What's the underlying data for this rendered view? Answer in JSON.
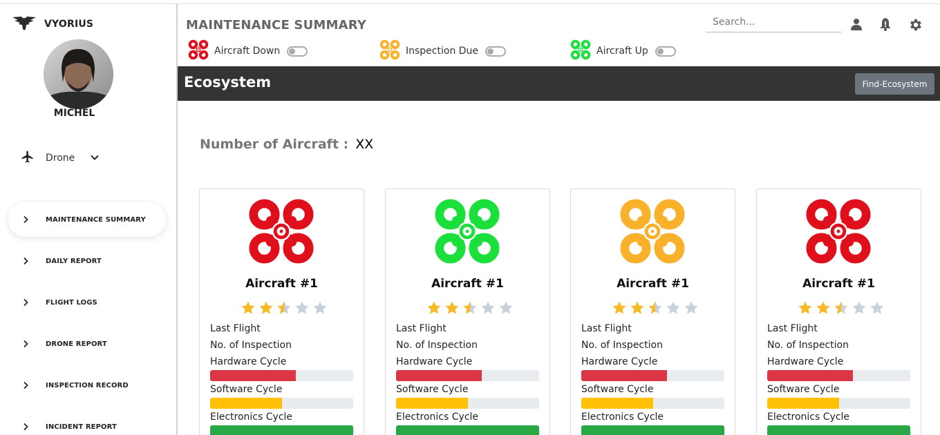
{
  "brand": {
    "name": "VYORIUS"
  },
  "user": {
    "name": "MICHEL"
  },
  "drone_select": {
    "value": "Drone"
  },
  "nav": {
    "items": [
      {
        "label": "MAINTENANCE SUMMARY",
        "active": true
      },
      {
        "label": "DAILY REPORT",
        "active": false
      },
      {
        "label": "FLIGHT LOGS",
        "active": false
      },
      {
        "label": "DRONE REPORT",
        "active": false
      },
      {
        "label": "INSPECTION RECORD",
        "active": false
      },
      {
        "label": "INCIDENT REPORT",
        "active": false
      }
    ]
  },
  "header": {
    "title": "MAINTENANCE SUMMARY",
    "legend": [
      {
        "label": "Aircraft Down",
        "color": "#e00f1c"
      },
      {
        "label": "Inspection Due",
        "color": "#f9b12c"
      },
      {
        "label": "Aircraft Up",
        "color": "#1be03c"
      }
    ],
    "search_placeholder": "Search..."
  },
  "ecosystem": {
    "title": "Ecosystem",
    "button_label": "Find-Ecosystem",
    "count_label": "Number of Aircraft :",
    "count_value": "XX"
  },
  "cards": [
    {
      "name": "Aircraft #1",
      "status_color": "#e00f1c",
      "rating": 2.5,
      "last_flight": "Last Flight",
      "inspection": "No. of Inspection",
      "hardware_label": "Hardware Cycle",
      "hardware_pct": 60,
      "software_label": "Software Cycle",
      "software_pct": 50,
      "electronics_label": "Electronics Cycle",
      "electronics_pct": 100
    },
    {
      "name": "Aircraft #1",
      "status_color": "#1be03c",
      "rating": 2.5,
      "last_flight": "Last Flight",
      "inspection": "No. of Inspection",
      "hardware_label": "Hardware Cycle",
      "hardware_pct": 60,
      "software_label": "Software Cycle",
      "software_pct": 50,
      "electronics_label": "Electronics Cycle",
      "electronics_pct": 100
    },
    {
      "name": "Aircraft #1",
      "status_color": "#f9b12c",
      "rating": 2.5,
      "last_flight": "Last Flight",
      "inspection": "No. of Inspection",
      "hardware_label": "Hardware Cycle",
      "hardware_pct": 60,
      "software_label": "Software Cycle",
      "software_pct": 50,
      "electronics_label": "Electronics Cycle",
      "electronics_pct": 100
    },
    {
      "name": "Aircraft #1",
      "status_color": "#e00f1c",
      "rating": 2.5,
      "last_flight": "Last Flight",
      "inspection": "No. of Inspection",
      "hardware_label": "Hardware Cycle",
      "hardware_pct": 60,
      "software_label": "Software Cycle",
      "software_pct": 50,
      "electronics_label": "Electronics Cycle",
      "electronics_pct": 100
    }
  ],
  "colors": {
    "hardware": "#dc3545",
    "software": "#ffc107",
    "electronics": "#28a745",
    "star_on": "#f7b924",
    "star_off": "#c9d1db"
  }
}
